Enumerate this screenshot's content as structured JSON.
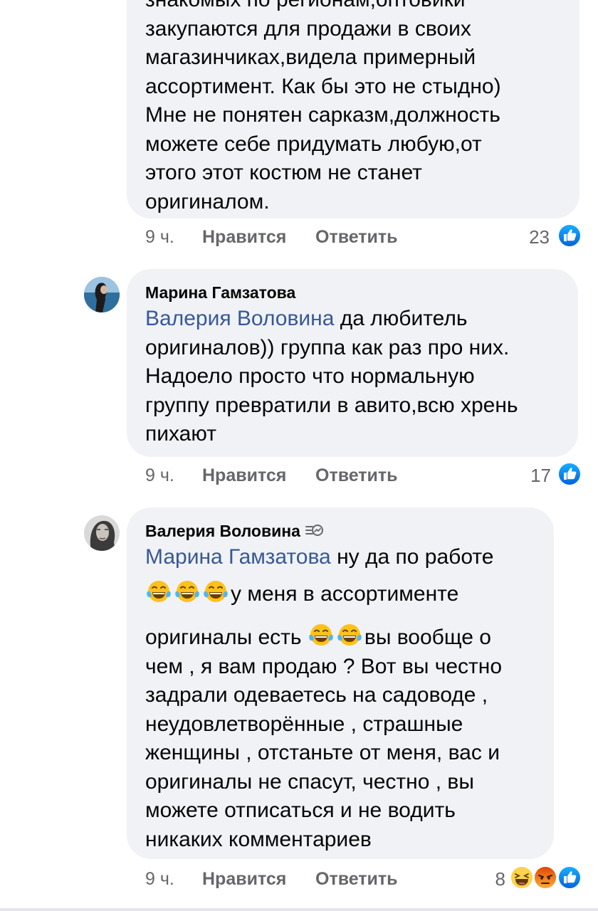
{
  "comments": [
    {
      "text_lines": [
        "знакомых по регионам,оптовики",
        "закупаются для продажи в своих",
        "магазинчиках,видела примерный",
        "ассортимент. Как бы это не стыдно)",
        "Мне не понятен сарказм,должность",
        "можете себе придумать любую,от",
        "этого этот костюм не станет",
        "оригиналом."
      ],
      "time": "9 ч.",
      "like_label": "Нравится",
      "reply_label": "Ответить",
      "reaction_count": "23",
      "reactions": [
        "like-icon"
      ]
    },
    {
      "author": "Марина Гамзатова",
      "mention": "Валерия Воловина",
      "text_after_mention": " да любитель",
      "text_lines": [
        "оригиналов)) группа как раз про них.",
        "Надоело просто что нормальную",
        "группу превратили в авито,всю хрень",
        "пихают"
      ],
      "time": "9 ч.",
      "like_label": "Нравится",
      "reply_label": "Ответить",
      "reaction_count": "17",
      "reactions": [
        "like-icon"
      ]
    },
    {
      "author": "Валерия Воловина",
      "author_badge": "messenger-icon",
      "mention": "Марина Гамзатова",
      "text_after_mention": " ну да по работе",
      "line2_emoji_count": 3,
      "line2_text": "у меня в ассортименте",
      "line3_text": "оригиналы есть ",
      "line3_emoji_count": 2,
      "line3_tail": "вы вообще о",
      "text_lines": [
        "чем , я вам продаю ? Вот вы честно",
        "задрали одеваетесь на садоводе ,",
        "неудовлетворённые , страшные",
        "женщины , отстаньте от меня, вас и",
        "оригиналы не спасут, честно , вы",
        "можете отписаться и не водить",
        "никаких комментариев"
      ],
      "time": "9 ч.",
      "like_label": "Нравится",
      "reply_label": "Ответить",
      "reaction_count": "8",
      "reactions": [
        "haha-icon",
        "angry-icon",
        "like-icon"
      ]
    }
  ],
  "colors": {
    "bubble": "#f0f2f5",
    "mention": "#385898",
    "meta": "#65676b",
    "like_blue": "#1877f2"
  }
}
